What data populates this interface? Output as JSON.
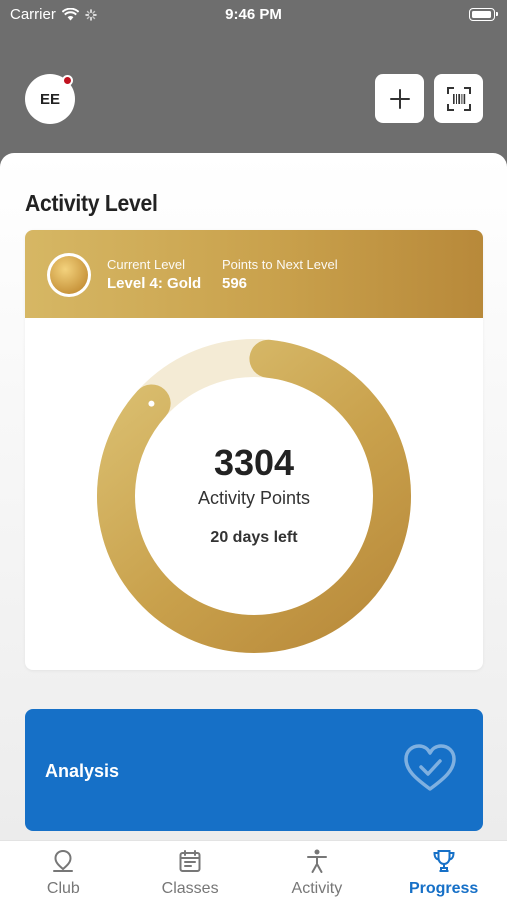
{
  "status_bar": {
    "carrier": "Carrier",
    "time": "9:46 PM"
  },
  "header": {
    "avatar_initials": "EE"
  },
  "activity": {
    "section_title": "Activity Level",
    "current_level_label": "Current Level",
    "current_level_value": "Level 4: Gold",
    "points_next_label": "Points to Next Level",
    "points_next_value": "596",
    "points": "3304",
    "points_label": "Activity Points",
    "days_left": "20 days left",
    "progress_fraction": 0.85
  },
  "analysis": {
    "label": "Analysis"
  },
  "tabs": [
    {
      "label": "Club",
      "icon": "pin-icon"
    },
    {
      "label": "Classes",
      "icon": "calendar-icon"
    },
    {
      "label": "Activity",
      "icon": "person-icon"
    },
    {
      "label": "Progress",
      "icon": "trophy-icon"
    }
  ],
  "colors": {
    "gold": "#c9a14c",
    "gold_light": "#f4ebd5",
    "blue": "#1670c7",
    "top_gray": "#6e6e6e"
  }
}
